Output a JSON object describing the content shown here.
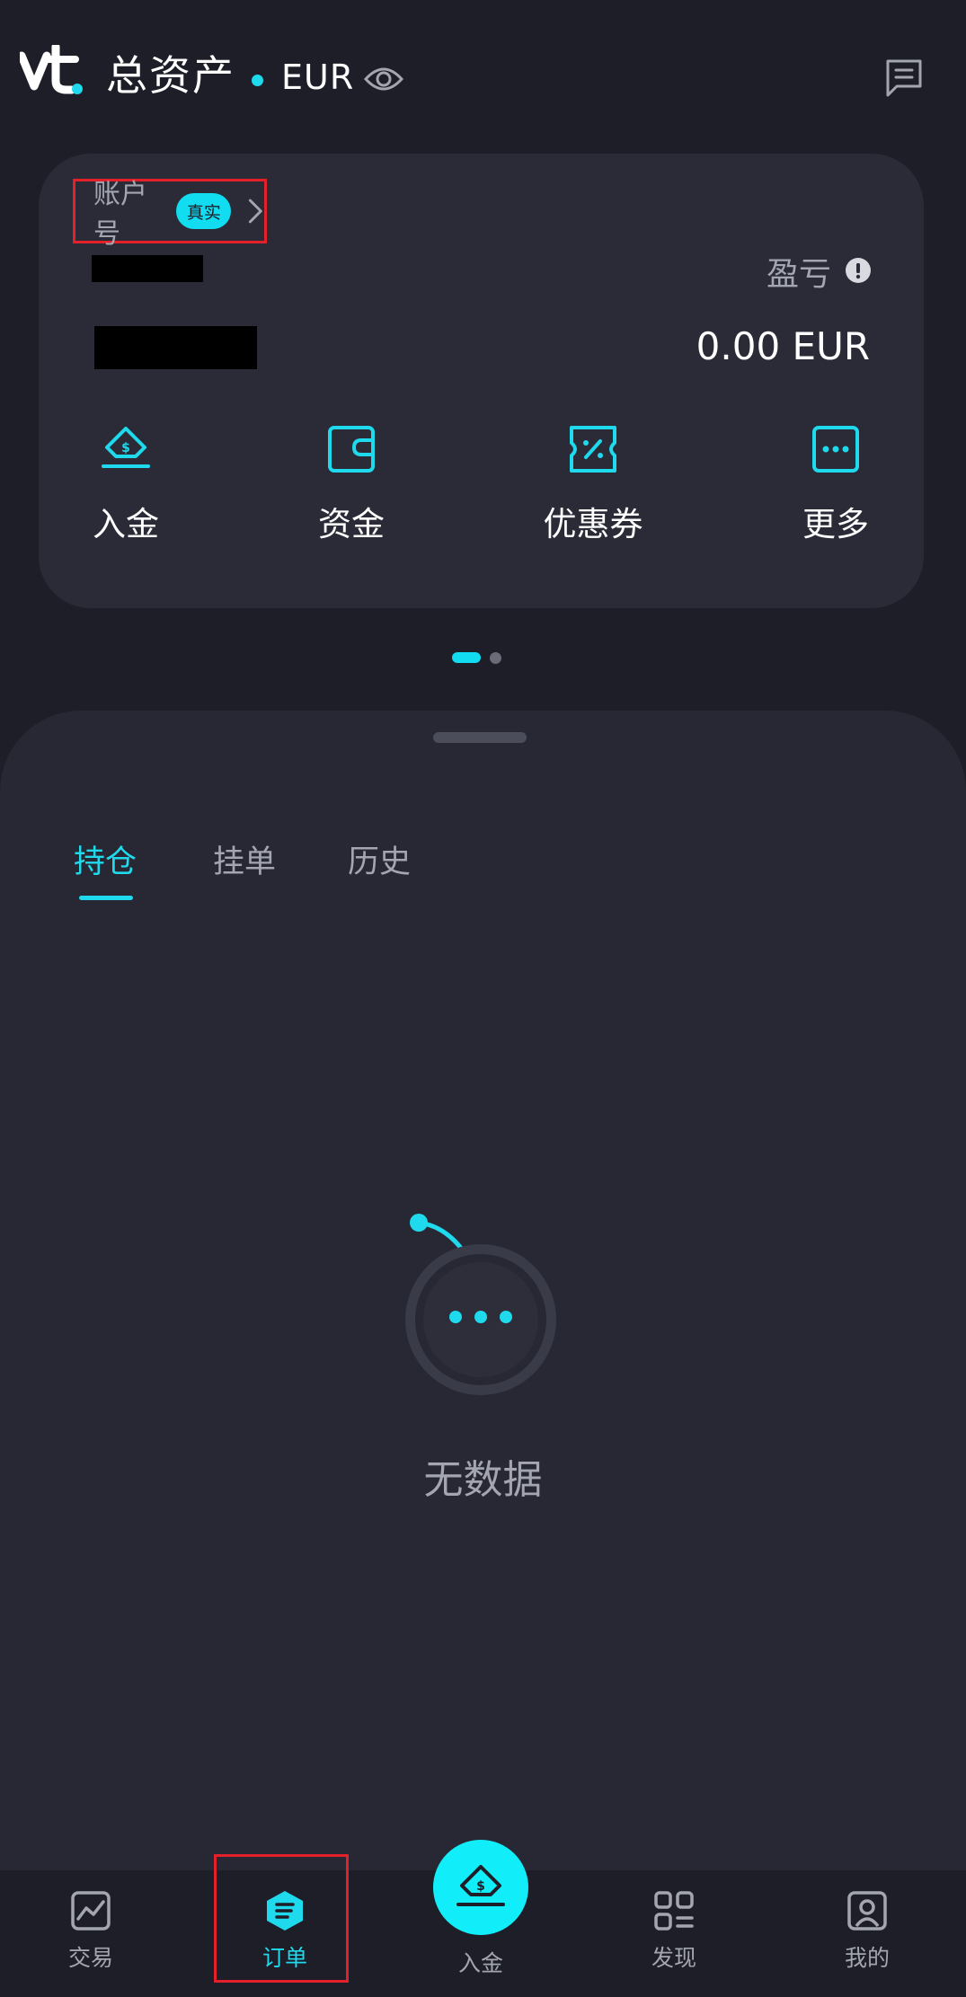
{
  "header": {
    "title": "总资产",
    "currency": "EUR",
    "eye_icon": "eye-icon",
    "message_icon": "message-icon"
  },
  "account": {
    "label": "账户号",
    "badge": "真实",
    "pl_label": "盈亏",
    "pl_value": "0.00 EUR"
  },
  "actions": [
    {
      "label": "入金",
      "icon": "deposit-icon"
    },
    {
      "label": "资金",
      "icon": "wallet-icon"
    },
    {
      "label": "优惠券",
      "icon": "coupon-icon"
    },
    {
      "label": "更多",
      "icon": "more-icon"
    }
  ],
  "tabs": [
    {
      "label": "持仓",
      "active": true
    },
    {
      "label": "挂单",
      "active": false
    },
    {
      "label": "历史",
      "active": false
    }
  ],
  "empty": {
    "text": "无数据"
  },
  "nav": [
    {
      "label": "交易",
      "icon": "chart-icon"
    },
    {
      "label": "订单",
      "icon": "orders-icon",
      "active": true
    },
    {
      "label": "入金",
      "icon": "deposit-icon"
    },
    {
      "label": "发现",
      "icon": "discover-icon"
    },
    {
      "label": "我的",
      "icon": "profile-icon"
    }
  ],
  "colors": {
    "accent": "#11dcf0",
    "background": "#1d1e27",
    "card": "#2a2b37",
    "highlight_box": "#e4202a"
  }
}
